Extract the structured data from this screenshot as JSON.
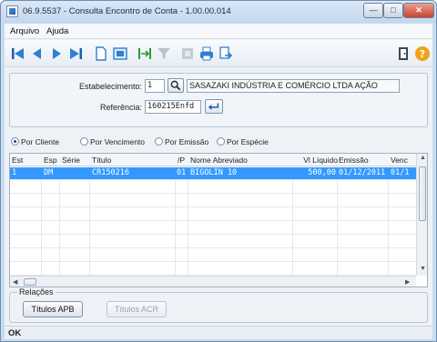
{
  "window": {
    "title": "06.9.5537 - Consulta Encontro de Conta - 1.00.00.014"
  },
  "menu": [
    "Arquivo",
    "Ajuda"
  ],
  "header": {
    "estabelecimento_label": "Estabelecimento:",
    "estabelecimento_value": "1",
    "empresa_nome": "SASAZAKI INDÚSTRIA E COMÉRCIO LTDA AÇÃO",
    "referencia_label": "Referência:",
    "referencia_value": "160215Enfd"
  },
  "radios": [
    {
      "label": "Por Cliente",
      "checked": true
    },
    {
      "label": "Por Vencimento",
      "checked": false
    },
    {
      "label": "Por Emissão",
      "checked": false
    },
    {
      "label": "Por Espécie",
      "checked": false
    }
  ],
  "grid": {
    "columns": [
      "Est",
      "Esp",
      "Série",
      "Título",
      "/P",
      "Nome Abreviado",
      "Vl Líquido",
      "Emissão",
      "Venc"
    ],
    "rows": [
      {
        "est": "1",
        "esp": "DM",
        "serie": "",
        "titulo": "CR150216",
        "p": "01",
        "nome": "BIGOLIN 10",
        "vl_liquido": "500,00",
        "emissao": "01/12/2011",
        "venc": "01/1"
      }
    ]
  },
  "relations": {
    "label": "Relações",
    "buttons": [
      {
        "label": "Títulos APB",
        "enabled": true
      },
      {
        "label": "Títulos ACR",
        "enabled": false
      }
    ]
  },
  "status": {
    "text": "OK"
  },
  "colors": {
    "selection": "#3399ff",
    "accent": "#1d5fa8"
  }
}
